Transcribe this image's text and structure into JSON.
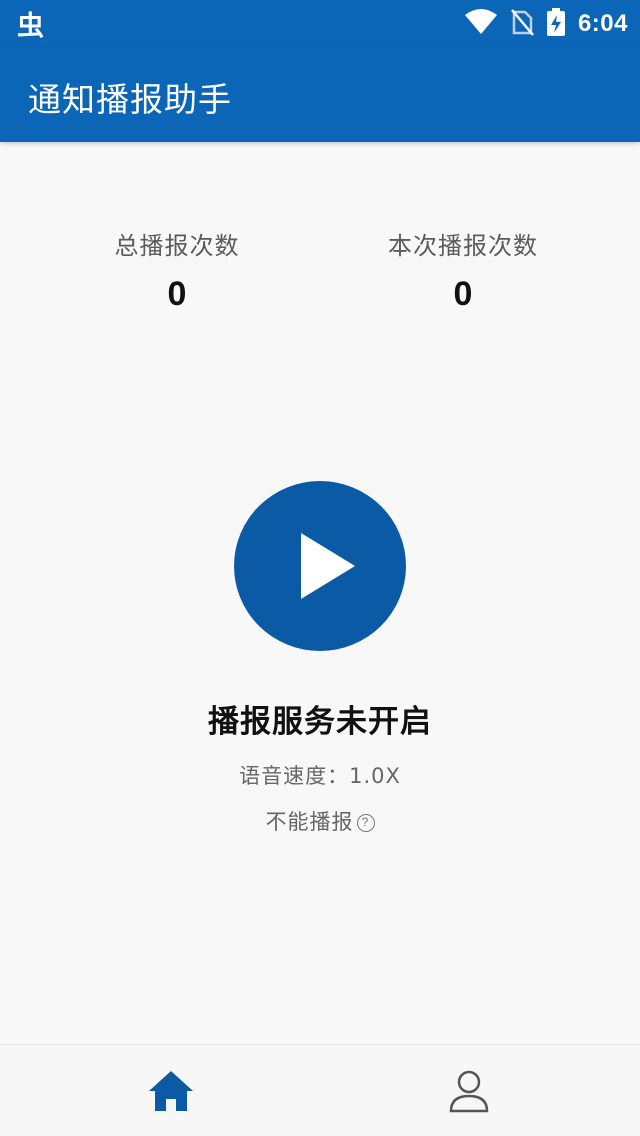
{
  "status_bar": {
    "time": "6:04",
    "left_icon": "app-notification-icon",
    "icons": [
      "wifi-icon",
      "no-sim-icon",
      "battery-charging-icon"
    ]
  },
  "app": {
    "title": "通知播报助手",
    "accent_color": "#0b66b7"
  },
  "stats": {
    "total_label": "总播报次数",
    "total_value": "0",
    "session_label": "本次播报次数",
    "session_value": "0"
  },
  "player": {
    "play_icon": "play-icon",
    "status_text": "播报服务未开启",
    "speed_text": "语音速度：1.0X",
    "cannot_text": "不能播报",
    "help_mark": "?"
  },
  "bottom_nav": {
    "items": [
      {
        "icon": "home-icon",
        "active": true,
        "color": "#0b5aa6"
      },
      {
        "icon": "user-icon",
        "active": false,
        "color": "#555555"
      }
    ]
  }
}
